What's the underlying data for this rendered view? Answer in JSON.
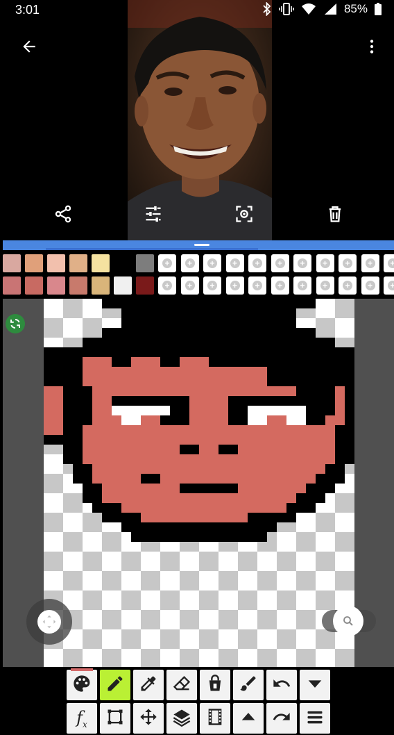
{
  "status_bar": {
    "time": "3:01",
    "battery": "85%"
  },
  "palette": {
    "row1": [
      "#d9a8a0",
      "#e0a07a",
      "#f2c0ad",
      "#e0b088",
      "#f5e2a0",
      "#000000",
      "#7d7d7d"
    ],
    "row2": [
      "#c97474",
      "#c86a62",
      "#d9878c",
      "#c87a6c",
      "#d9b57a",
      "#f0f0f0",
      "#7a1a1a"
    ],
    "add_slot_glyph": "+"
  },
  "pixel_art": {
    "colors": {
      "K": "#000000",
      "S": "#d46a60",
      "W": "#ffffff",
      "G": "#c7c7c7",
      "L": "#ffffff"
    },
    "rows": [
      "......KKKKKKKKKKKKKKKKKKKKKK....",
      "........KKKKKKKKKKKKKKKKKK......",
      "........KKKKKKKKKKKKKKKKKK......",
      "......KKKKKKKKKKKKKKKKKKKKKK....",
      "....KKKKKKKKKKKKKKKKKKKKKKKKKK..",
      "KKKKKKKKKKKKKKKKKKKKKKKKKKKKKKKK",
      "KKKKSSSKKSSSKKSSSKKKKKKKKKKKKKKK",
      "KKKKSSSSSSSSSSSSSSSSSSSKKKKKKKKK",
      "KKKKSSSSSSSSSSSSSSSSSSSKKKKKKKKK",
      "SSKKKSSSSSSSSSSSSSSSSSSSSSKKKKSK",
      "SSKKKSSKKKKKKKKSSSSKKKKKKKKKKKSK",
      "SSKKKSSWWWWWWKKSSSSKKWWWWWWKKKSK",
      "SSKKKSSSWWSSKKKSSSSKKWWSSWWKKSSK",
      "SSKKSSSSSSSSSSSSSSSSSSSSSSSSSSKK",
      "KKKKSSSSSSSSSSSSSSSSSSSSSSSSSSKK",
      "..KKSSSSSSSSSSKKSSKKSSSSSSSSSSKK",
      "..KKSSSSSSSSSSSSSSSSSSSSSSSSSSKK",
      "...KKSSSSSSSSSSSSSSSSSSSSSSSSKK.",
      "...KKSSSSSKKSSSSSSSSSSSSSSSSKKK.",
      "....KKSSSSSSSSKKKKKKSSSSSSSKKK..",
      "....KKSSSSSSSSSSSSSSSSSSSSKKK...",
      ".....KKKSSSSSSSSSSSSSSSSSKKK....",
      "......KKKKSSSSSSSSSSSKKKKK......",
      "........KKKKKKKKKKKKKKKK........",
      ".........KKKKKKKKKKKKKK........."
    ],
    "note_checker": "transparent pixels rendered as light checkerboard"
  },
  "toolbar": {
    "row1": [
      "palette-icon",
      "pencil-icon",
      "eyedropper-icon",
      "eraser-icon",
      "fill-bucket-icon",
      "brush-icon",
      "undo-icon",
      "triangle-down-icon"
    ],
    "row2": [
      "function-icon",
      "select-rect-icon",
      "move-arrows-icon",
      "layers-icon",
      "film-icon",
      "triangle-up-icon",
      "redo-icon",
      "menu-icon"
    ],
    "fx_label": "f",
    "fx_sub": "x"
  }
}
